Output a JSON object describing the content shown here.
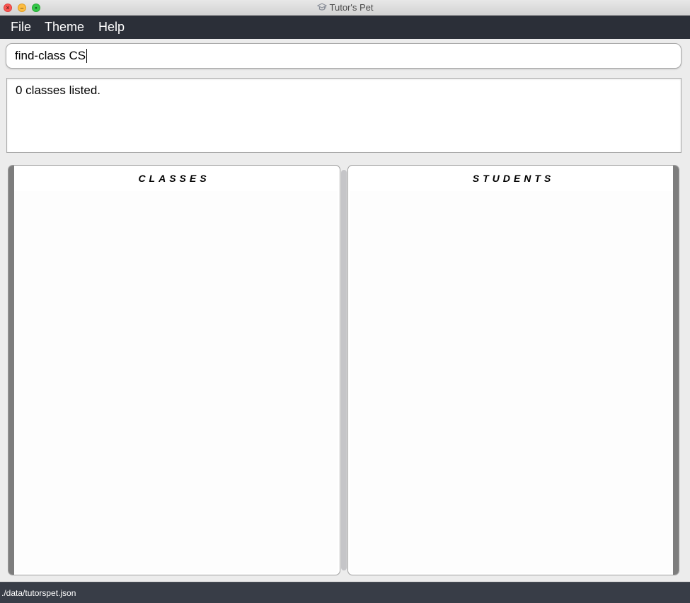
{
  "window": {
    "title": "Tutor's Pet",
    "app_icon": "graduation-cap-icon"
  },
  "menu": {
    "items": [
      {
        "label": "File"
      },
      {
        "label": "Theme"
      },
      {
        "label": "Help"
      }
    ]
  },
  "command": {
    "value": "find-class CS"
  },
  "result": {
    "message": "0 classes listed."
  },
  "panels": {
    "classes": {
      "header": "CLASSES",
      "items": []
    },
    "students": {
      "header": "STUDENTS",
      "items": []
    }
  },
  "status": {
    "file_path": "./data/tutorspet.json"
  },
  "colors": {
    "menubar_bg": "#2b2f38",
    "statusbar_bg": "#383d47",
    "panel_side_bar": "#7d7d7d"
  }
}
